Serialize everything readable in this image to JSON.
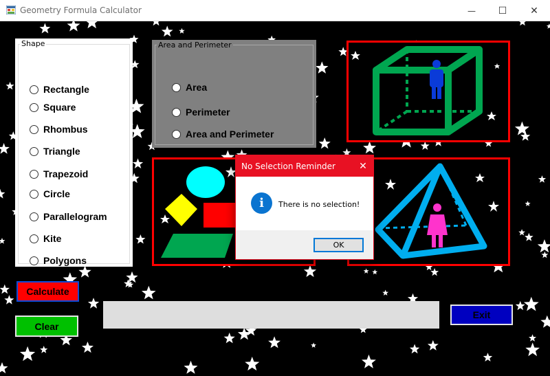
{
  "window": {
    "title": "Geometry Formula Calculator",
    "minimize_glyph": "—",
    "maximize_glyph": "☐",
    "close_glyph": "✕"
  },
  "shape_group": {
    "legend": "Shape",
    "options": [
      "Rectangle",
      "Square",
      "Rhombus",
      "Triangle",
      "Trapezoid",
      "Circle",
      "Parallelogram",
      "Kite",
      "Polygons"
    ]
  },
  "calc_group": {
    "legend": "Area and Perimeter",
    "options": [
      "Area",
      "Perimeter",
      "Area and Perimeter"
    ]
  },
  "buttons": {
    "calculate": "Calculate",
    "clear": "Clear",
    "exit": "Exit"
  },
  "output": {
    "value": ""
  },
  "dialog": {
    "title": "No Selection Reminder",
    "close_glyph": "✕",
    "icon_glyph": "i",
    "message": "There is no selection!",
    "ok": "OK"
  },
  "images": {
    "top_right": "cube-with-person-icon",
    "left": "2d-shapes-icon",
    "right": "pyramid-with-person-icon"
  },
  "colors": {
    "background": "#000000",
    "frame_red": "#ff0000",
    "calc_button": "#ff0000",
    "clear_button": "#00c000",
    "exit_button": "#0000c0",
    "cube_green": "#00a650",
    "pyramid_blue": "#00aeef",
    "dialog_accent": "#e81123"
  }
}
